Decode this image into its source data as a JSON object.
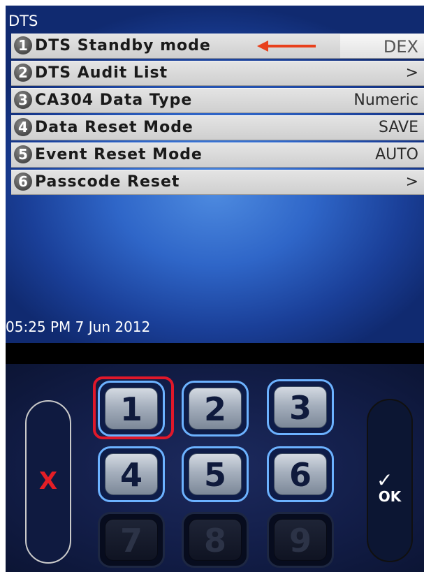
{
  "screen": {
    "title": "DTS",
    "timestamp": "05:25 PM 7 Jun 2012"
  },
  "menu": {
    "items": [
      {
        "number": "1",
        "label": "DTS Standby mode",
        "value": "DEX"
      },
      {
        "number": "2",
        "label": "DTS Audit List",
        "value": ">"
      },
      {
        "number": "3",
        "label": "CA304 Data Type",
        "value": "Numeric"
      },
      {
        "number": "4",
        "label": "Data Reset Mode",
        "value": "SAVE"
      },
      {
        "number": "5",
        "label": "Event Reset Mode",
        "value": "AUTO"
      },
      {
        "number": "6",
        "label": "Passcode Reset",
        "value": ">"
      }
    ]
  },
  "annotation": {
    "arrow_color": "#e8401c",
    "highlight_color": "#e0182a"
  },
  "keypad": {
    "cancel_label": "X",
    "ok_label": "OK",
    "ok_check": "✓",
    "keys": [
      "1",
      "2",
      "3",
      "4",
      "5",
      "6",
      "7",
      "8",
      "9"
    ],
    "enabled_keys": [
      "1",
      "2",
      "3",
      "4",
      "5",
      "6"
    ],
    "disabled_keys": [
      "7",
      "8",
      "9"
    ],
    "highlighted_key": "1"
  },
  "colors": {
    "screen_blue": "#2f66c8",
    "key_border": "#6cb2ff",
    "cancel_red": "#e41e26"
  }
}
